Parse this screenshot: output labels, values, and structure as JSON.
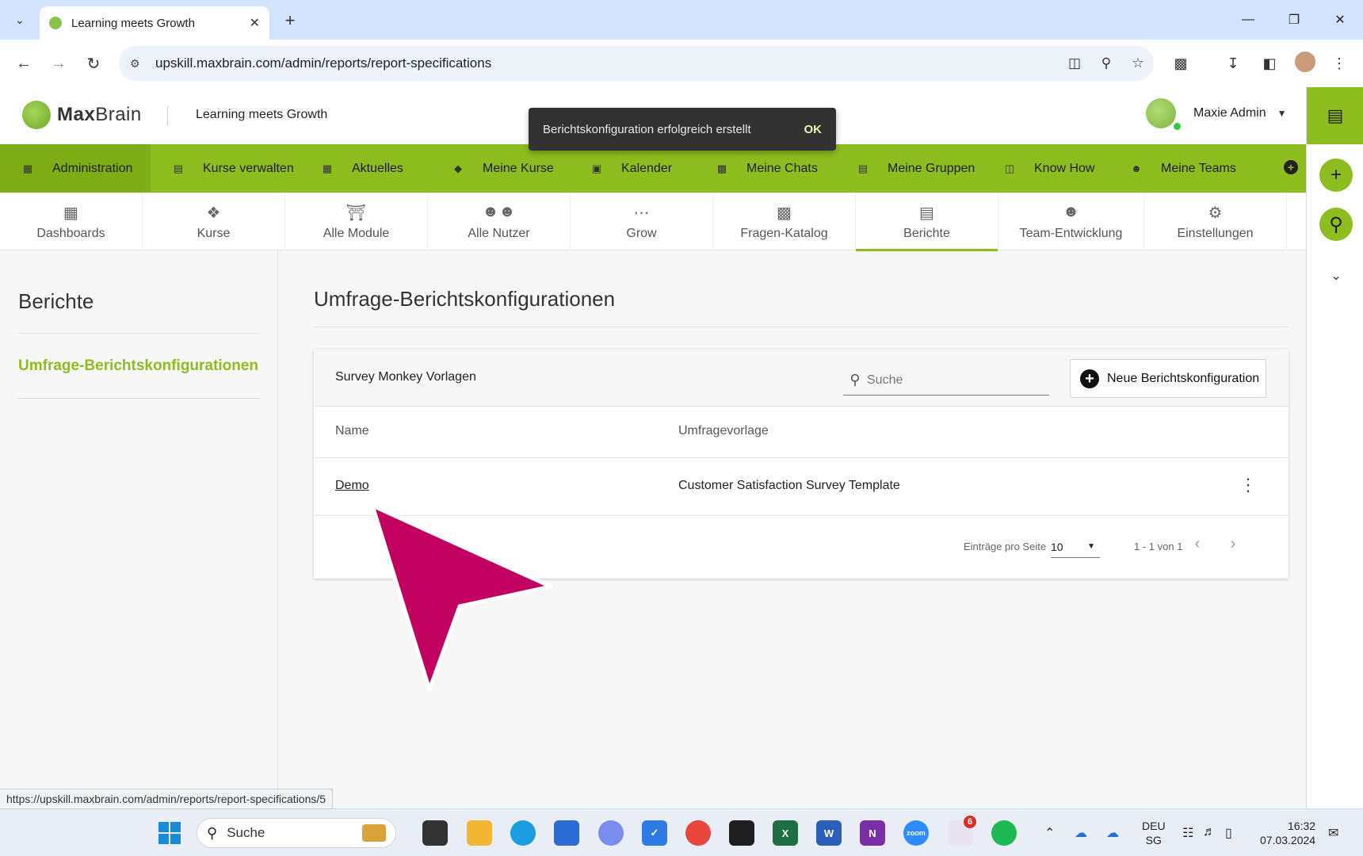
{
  "browser": {
    "tab_title": "Learning meets Growth",
    "url": "upskill.maxbrain.com/admin/reports/report-specifications",
    "status_url": "https://upskill.maxbrain.com/admin/reports/report-specifications/5"
  },
  "header": {
    "logo_text_bold": "Max",
    "logo_text_rest": "Brain",
    "tagline": "Learning meets Growth",
    "user_name": "Maxie Admin"
  },
  "snackbar": {
    "message": "Berichtskonfiguration erfolgreich erstellt",
    "action": "OK"
  },
  "main_nav": {
    "items": [
      {
        "label": "Administration",
        "icon": "dashboard-icon",
        "active": true
      },
      {
        "label": "Kurse verwalten",
        "icon": "folder-icon"
      },
      {
        "label": "Aktuelles",
        "icon": "grid-icon"
      },
      {
        "label": "Meine Kurse",
        "icon": "graduation-cap-icon"
      },
      {
        "label": "Kalender",
        "icon": "calendar-icon"
      },
      {
        "label": "Meine Chats",
        "icon": "chat-icon"
      },
      {
        "label": "Meine Gruppen",
        "icon": "folder-users-icon"
      },
      {
        "label": "Know How",
        "icon": "book-icon"
      },
      {
        "label": "Meine Teams",
        "icon": "team-icon"
      }
    ]
  },
  "sub_tabs": [
    {
      "label": "Dashboards",
      "icon": "dashboard-icon"
    },
    {
      "label": "Kurse",
      "icon": "course-icon"
    },
    {
      "label": "Alle Module",
      "icon": "institution-icon"
    },
    {
      "label": "Alle Nutzer",
      "icon": "users-icon"
    },
    {
      "label": "Grow",
      "icon": "group-icon"
    },
    {
      "label": "Fragen-Katalog",
      "icon": "forum-icon"
    },
    {
      "label": "Berichte",
      "icon": "report-icon",
      "active": true
    },
    {
      "label": "Team-Entwicklung",
      "icon": "team-icon"
    },
    {
      "label": "Einstellungen",
      "icon": "settings-icon"
    }
  ],
  "sidebar": {
    "title": "Berichte",
    "item": "Umfrage-Berichtskonfigurationen"
  },
  "main": {
    "page_title": "Umfrage-Berichtskonfigurationen",
    "card_title": "Survey Monkey Vorlagen",
    "search_placeholder": "Suche",
    "new_button": "Neue Berichtskonfiguration",
    "columns": [
      "Name",
      "Umfragevorlage"
    ],
    "rows": [
      {
        "name": "Demo",
        "template": "Customer Satisfaction Survey Template"
      }
    ],
    "pagination": {
      "per_page_label": "Einträge pro Seite",
      "per_page_value": "10",
      "range": "1 - 1 von 1"
    }
  },
  "taskbar": {
    "search": "Suche",
    "lang_top": "DEU",
    "lang_bottom": "SG",
    "time": "16:32",
    "date": "07.03.2024",
    "slack_badge": "6"
  },
  "colors": {
    "brand_green": "#8dbd1f",
    "arrow_magenta": "#c2005f"
  }
}
